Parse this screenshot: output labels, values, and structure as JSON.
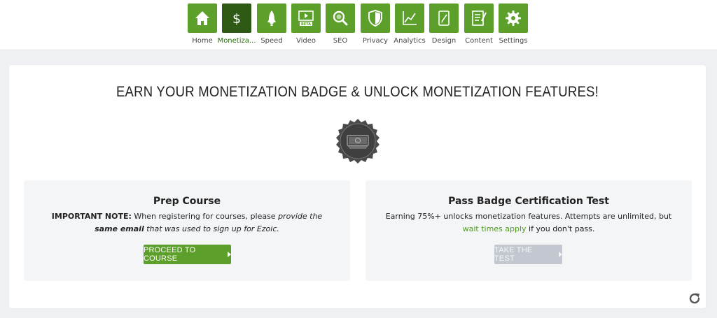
{
  "nav": {
    "items": [
      {
        "label": "Home",
        "icon": "home-icon"
      },
      {
        "label": "Monetiza...",
        "icon": "dollar-icon",
        "active": true
      },
      {
        "label": "Speed",
        "icon": "rocket-icon"
      },
      {
        "label": "Video",
        "icon": "video-icon",
        "badge": "BETA"
      },
      {
        "label": "SEO",
        "icon": "magnifier-icon"
      },
      {
        "label": "Privacy",
        "icon": "shield-icon"
      },
      {
        "label": "Analytics",
        "icon": "line-chart-icon"
      },
      {
        "label": "Design",
        "icon": "design-icon"
      },
      {
        "label": "Content",
        "icon": "document-edit-icon"
      },
      {
        "label": "Settings",
        "icon": "gear-icon"
      }
    ]
  },
  "main": {
    "headline": "EARN YOUR MONETIZATION BADGE & UNLOCK MONETIZATION FEATURES!",
    "badge_icon": "money-badge-icon",
    "prep": {
      "title": "Prep Course",
      "note_label": "IMPORTANT NOTE:",
      "note_text_1": " When registering for courses, please ",
      "note_em_1": "provide the ",
      "note_strong": "same email",
      "note_em_2": " that was used to sign up for Ezoic.",
      "button_label": "PROCEED TO COURSE"
    },
    "test": {
      "title": "Pass Badge Certification Test",
      "text_1": "Earning 75%+ unlocks monetization features. Attempts are unlimited, but ",
      "link_text": "wait times apply",
      "text_2": " if you don't pass.",
      "button_label": "TAKE THE TEST"
    }
  },
  "colors": {
    "accent_green": "#5c9f2a",
    "active_green": "#2e5a16",
    "link_green": "#4f9a1f",
    "disabled_button": "#c3c8d0"
  }
}
